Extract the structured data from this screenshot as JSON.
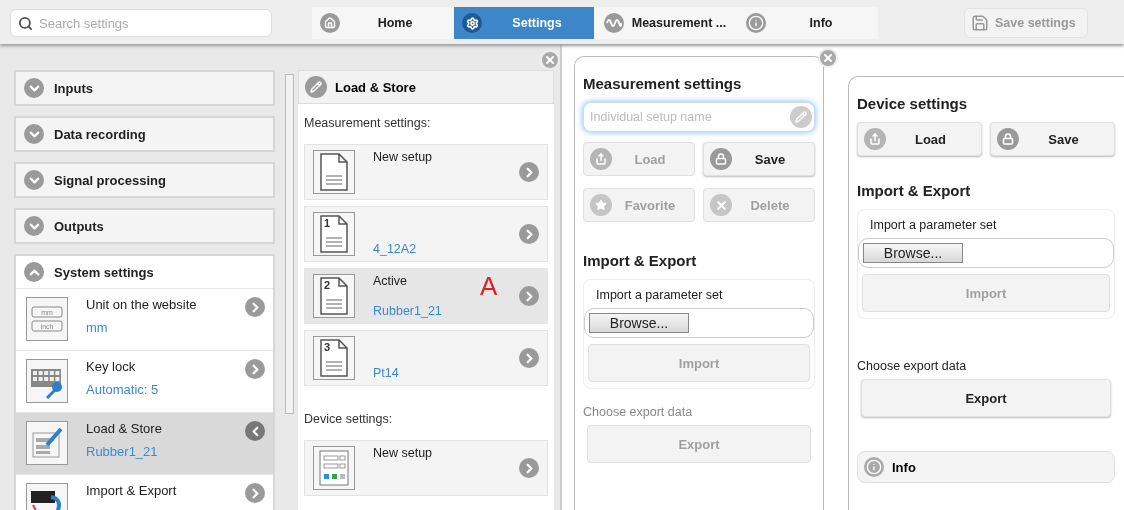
{
  "search": {
    "placeholder": "Search settings"
  },
  "nav": [
    {
      "label": "Home",
      "kind": "home",
      "selected": false
    },
    {
      "label": "Settings",
      "kind": "settings",
      "selected": true
    },
    {
      "label": "Measurement ...",
      "kind": "measurement",
      "selected": false
    },
    {
      "label": "Info",
      "kind": "info",
      "selected": false
    }
  ],
  "save_settings": {
    "label": "Save settings",
    "disabled": true
  },
  "sidebar": {
    "sections": [
      {
        "label": "Inputs",
        "expanded": false
      },
      {
        "label": "Data recording",
        "expanded": false
      },
      {
        "label": "Signal processing",
        "expanded": false
      },
      {
        "label": "Outputs",
        "expanded": false
      },
      {
        "label": "System settings",
        "expanded": true,
        "items": [
          {
            "title": "Unit on the website",
            "value": "mm",
            "kind": "units",
            "unit_a": "mm",
            "unit_b": "inch",
            "selected": false
          },
          {
            "title": "Key lock",
            "value": "Automatic: 5",
            "kind": "keylock",
            "selected": false
          },
          {
            "title": "Load & Store",
            "value": "Rubber1_21",
            "kind": "store",
            "selected": true
          },
          {
            "title": "Import & Export",
            "kind": "transfer",
            "selected": false
          }
        ]
      }
    ]
  },
  "load_store": {
    "title": "Load & Store",
    "measurement_heading": "Measurement settings:",
    "measurement_items": [
      {
        "title": "New setup",
        "selected": false
      },
      {
        "number": "1",
        "value": "4_12A2",
        "selected": false
      },
      {
        "number": "2",
        "title": "Active",
        "value": "Rubber1_21",
        "selected": true,
        "annotation": "A"
      },
      {
        "number": "3",
        "value": "Pt14",
        "selected": false
      }
    ],
    "device_heading": "Device settings:",
    "device_items": [
      {
        "title": "New setup",
        "selected": false
      }
    ]
  },
  "measurement_panel": {
    "title": "Measurement settings",
    "name_placeholder": "Individual setup name",
    "buttons": [
      {
        "label": "Load",
        "kind": "load",
        "disabled": true
      },
      {
        "label": "Save",
        "kind": "save",
        "disabled": false
      },
      {
        "label": "Favorite",
        "kind": "favorite",
        "disabled": true
      },
      {
        "label": "Delete",
        "kind": "delete",
        "disabled": true
      }
    ],
    "import_export_title": "Import & Export",
    "import_label": "Import a parameter set",
    "browse": "Browse...",
    "import_button": {
      "label": "Import",
      "disabled": true
    },
    "export_label": {
      "label": "Choose export data",
      "disabled": true
    },
    "export_button": {
      "label": "Export",
      "disabled": true
    }
  },
  "device_panel": {
    "title": "Device settings",
    "buttons": [
      {
        "label": "Load",
        "kind": "load",
        "disabled": false
      },
      {
        "label": "Save",
        "kind": "save",
        "disabled": false
      }
    ],
    "import_export_title": "Import & Export",
    "import_label": "Import a parameter set",
    "browse": "Browse...",
    "import_button": {
      "label": "Import",
      "disabled": true
    },
    "export_label": {
      "label": "Choose export data",
      "disabled": false
    },
    "export_button": {
      "label": "Export",
      "disabled": false
    },
    "info": "Info"
  }
}
